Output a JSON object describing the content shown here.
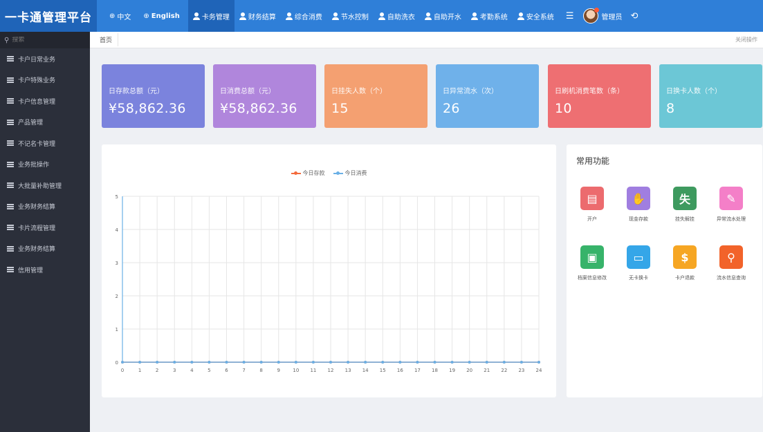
{
  "app": {
    "title": "一卡通管理平台"
  },
  "header": {
    "languages": [
      {
        "label": "中文",
        "icon": "globe-icon"
      },
      {
        "label": "English",
        "icon": "globe-icon"
      }
    ],
    "nav_tabs": [
      {
        "label": "卡务管理",
        "active": true
      },
      {
        "label": "财务结算",
        "active": false
      },
      {
        "label": "综合消费",
        "active": false
      },
      {
        "label": "节水控制",
        "active": false
      },
      {
        "label": "自助洗衣",
        "active": false
      },
      {
        "label": "自助开水",
        "active": false
      },
      {
        "label": "考勤系统",
        "active": false
      },
      {
        "label": "安全系统",
        "active": false
      }
    ],
    "menu_icon": "hamburger-icon",
    "user_name": "管理员",
    "logout_icon": "logout-icon"
  },
  "sidebar": {
    "search_placeholder": "搜索",
    "items": [
      {
        "label": "卡户日常业务"
      },
      {
        "label": "卡户特殊业务"
      },
      {
        "label": "卡户信息管理"
      },
      {
        "label": "产品管理"
      },
      {
        "label": "不记名卡管理"
      },
      {
        "label": "业务批操作"
      },
      {
        "label": "大批量补助管理"
      },
      {
        "label": "业务财务结算"
      },
      {
        "label": "卡片流程管理"
      },
      {
        "label": "业务财务结算"
      },
      {
        "label": "信用管理"
      }
    ]
  },
  "breadcrumb": {
    "tab": "首页",
    "close_ops": "关闭操作"
  },
  "stats": [
    {
      "label": "日存款总额（元）",
      "value": "¥58,862.36",
      "color": "#7b83dd"
    },
    {
      "label": "日消费总额（元）",
      "value": "¥58,862.36",
      "color": "#b086dc"
    },
    {
      "label": "日挂失人数（个）",
      "value": "15",
      "color": "#f4a071"
    },
    {
      "label": "日异常流水（次）",
      "value": "26",
      "color": "#6fb1ea"
    },
    {
      "label": "日刷机消费笔数（条）",
      "value": "10",
      "color": "#ee6f72"
    },
    {
      "label": "日换卡人数（个）",
      "value": "8",
      "color": "#6cc7d6"
    }
  ],
  "chart_data": {
    "type": "line",
    "title": "",
    "xlabel": "",
    "ylabel": "",
    "x": [
      0,
      1,
      2,
      3,
      4,
      5,
      6,
      7,
      8,
      9,
      10,
      11,
      12,
      13,
      14,
      15,
      16,
      17,
      18,
      19,
      20,
      21,
      22,
      23,
      24
    ],
    "ylim": [
      0,
      5
    ],
    "yticks": [
      0,
      1,
      2,
      3,
      4,
      5
    ],
    "grid": true,
    "legend_position": "top",
    "series": [
      {
        "name": "今日存款",
        "color": "#f46a3c",
        "values": [
          0,
          0,
          0,
          0,
          0,
          0,
          0,
          0,
          0,
          0,
          0,
          0,
          0,
          0,
          0,
          0,
          0,
          0,
          0,
          0,
          0,
          0,
          0,
          0,
          0
        ]
      },
      {
        "name": "今日消费",
        "color": "#6ab0e6",
        "values": [
          0,
          0,
          0,
          0,
          0,
          0,
          0,
          0,
          0,
          0,
          0,
          0,
          0,
          0,
          0,
          0,
          0,
          0,
          0,
          0,
          0,
          0,
          0,
          0,
          0
        ]
      }
    ]
  },
  "quick": {
    "title": "常用功能",
    "items": [
      {
        "label": "开户",
        "icon": "document-icon",
        "glyph": "▤",
        "color": "#ec6b6e"
      },
      {
        "label": "现金存款",
        "icon": "deposit-icon",
        "glyph": "✋",
        "color": "#a07ee0"
      },
      {
        "label": "挂失解挂",
        "icon": "lost-icon",
        "glyph": "失",
        "color": "#3e9a5f"
      },
      {
        "label": "异常流水处理",
        "icon": "edit-icon",
        "glyph": "✎",
        "color": "#f47fc8"
      },
      {
        "label": "档案信息修改",
        "icon": "briefcase-icon",
        "glyph": "▣",
        "color": "#37b36a"
      },
      {
        "label": "无卡换卡",
        "icon": "card-icon",
        "glyph": "▭",
        "color": "#35a6e8"
      },
      {
        "label": "卡户退款",
        "icon": "money-bag-icon",
        "glyph": "$",
        "color": "#f6a623"
      },
      {
        "label": "流水信息查询",
        "icon": "search-icon",
        "glyph": "⚲",
        "color": "#f2632a"
      }
    ]
  }
}
